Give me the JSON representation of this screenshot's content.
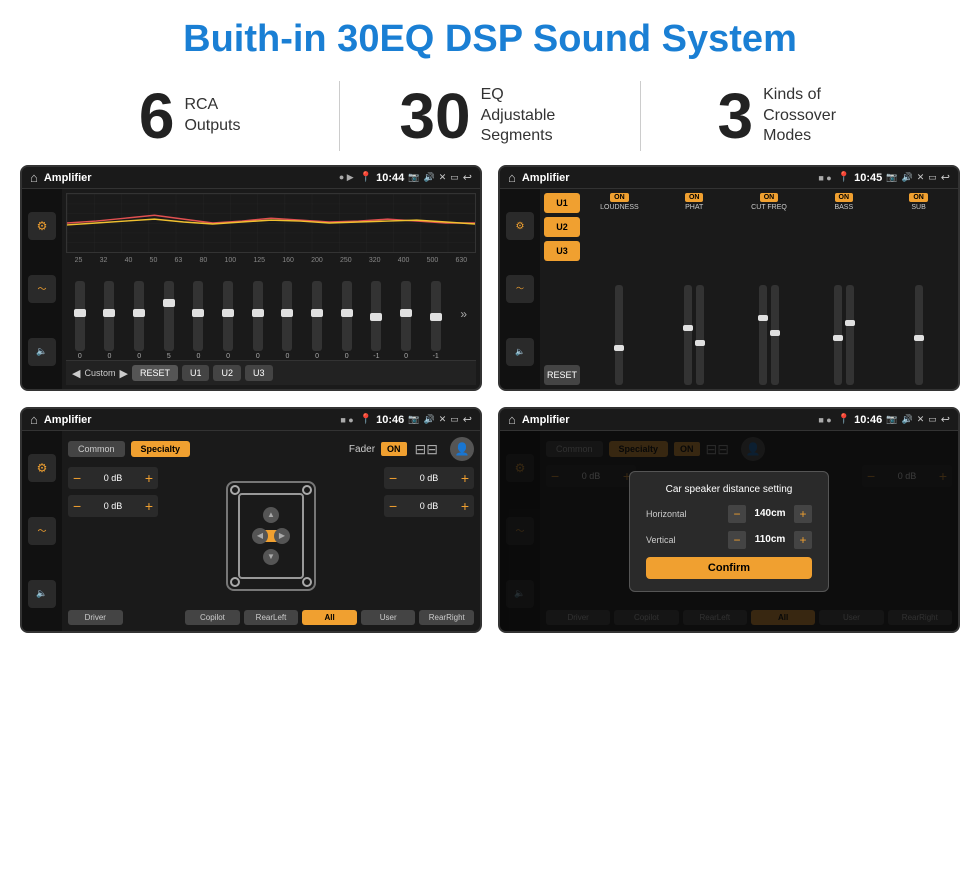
{
  "header": {
    "title": "Buith-in 30EQ DSP Sound System"
  },
  "stats": [
    {
      "number": "6",
      "label": "RCA\nOutputs"
    },
    {
      "number": "30",
      "label": "EQ Adjustable\nSegments"
    },
    {
      "number": "3",
      "label": "Kinds of\nCrossover Modes"
    }
  ],
  "screens": {
    "eq1": {
      "app_name": "Amplifier",
      "time": "10:44",
      "freq_labels": [
        "25",
        "32",
        "40",
        "50",
        "63",
        "80",
        "100",
        "125",
        "160",
        "200",
        "250",
        "320",
        "400",
        "500",
        "630"
      ],
      "slider_values": [
        "0",
        "0",
        "0",
        "5",
        "0",
        "0",
        "0",
        "0",
        "0",
        "0",
        "-1",
        "0",
        "-1"
      ],
      "bottom_buttons": [
        "Custom",
        "RESET",
        "U1",
        "U2",
        "U3"
      ]
    },
    "eq2": {
      "app_name": "Amplifier",
      "time": "10:45",
      "presets": [
        "U1",
        "U2",
        "U3"
      ],
      "columns": [
        {
          "on": true,
          "label": "LOUDNESS"
        },
        {
          "on": true,
          "label": "PHAT"
        },
        {
          "on": true,
          "label": "CUT FREQ"
        },
        {
          "on": true,
          "label": "BASS"
        },
        {
          "on": true,
          "label": "SUB"
        }
      ],
      "reset_label": "RESET"
    },
    "fader1": {
      "app_name": "Amplifier",
      "time": "10:46",
      "tabs": [
        "Common",
        "Specialty"
      ],
      "fader_label": "Fader",
      "fader_on": "ON",
      "db_values": [
        "0 dB",
        "0 dB",
        "0 dB",
        "0 dB"
      ],
      "bottom_buttons": [
        "Driver",
        "",
        "Copilot",
        "RearLeft",
        "All",
        "User",
        "RearRight"
      ]
    },
    "fader2": {
      "app_name": "Amplifier",
      "time": "10:46",
      "tabs": [
        "Common",
        "Specialty"
      ],
      "dialog": {
        "title": "Car speaker distance setting",
        "horizontal_label": "Horizontal",
        "horizontal_value": "140cm",
        "vertical_label": "Vertical",
        "vertical_value": "110cm",
        "confirm_label": "Confirm"
      },
      "db_values": [
        "0 dB",
        "0 dB"
      ],
      "bottom_buttons": [
        "Driver",
        "Copilot",
        "RearLeft",
        "All",
        "User",
        "RearRight"
      ]
    }
  },
  "icons": {
    "home": "⌂",
    "back": "↩",
    "location": "📍",
    "volume": "🔊",
    "camera": "📷",
    "equalizer": "≋",
    "waveform": "〜",
    "speaker": "🔈"
  }
}
